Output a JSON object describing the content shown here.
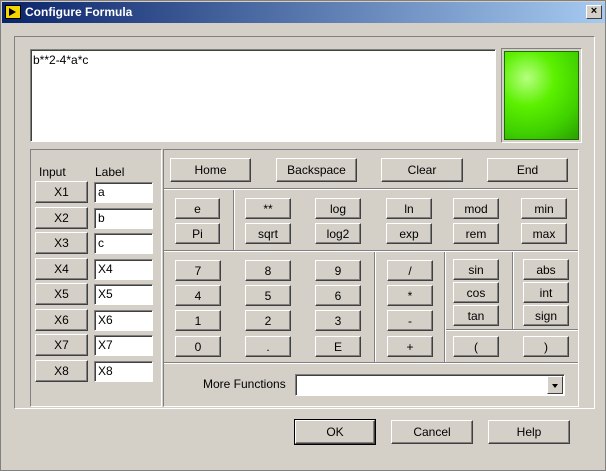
{
  "window": {
    "title": "Configure Formula",
    "close_label": "×"
  },
  "formula": {
    "value": "b**2-4*a*c"
  },
  "led": {
    "state": "on",
    "color": "#4ce000"
  },
  "variables": {
    "input_header": "Input",
    "label_header": "Label",
    "rows": [
      {
        "input": "X1",
        "label": "a"
      },
      {
        "input": "X2",
        "label": "b"
      },
      {
        "input": "X3",
        "label": "c"
      },
      {
        "input": "X4",
        "label": "X4"
      },
      {
        "input": "X5",
        "label": "X5"
      },
      {
        "input": "X6",
        "label": "X6"
      },
      {
        "input": "X7",
        "label": "X7"
      },
      {
        "input": "X8",
        "label": "X8"
      }
    ]
  },
  "edit": {
    "home": "Home",
    "backspace": "Backspace",
    "clear": "Clear",
    "end": "End"
  },
  "constants": {
    "e": "e",
    "pi": "Pi"
  },
  "functions": {
    "pow": "**",
    "log": "log",
    "ln": "ln",
    "mod": "mod",
    "min": "min",
    "sqrt": "sqrt",
    "log2": "log2",
    "exp": "exp",
    "rem": "rem",
    "max": "max"
  },
  "keypad": {
    "d7": "7",
    "d8": "8",
    "d9": "9",
    "d4": "4",
    "d5": "5",
    "d6": "6",
    "d1": "1",
    "d2": "2",
    "d3": "3",
    "d0": "0",
    "dot": ".",
    "E": "E"
  },
  "operators": {
    "divide": "/",
    "multiply": "*",
    "minus": "-",
    "plus": "+"
  },
  "trig": {
    "sin": "sin",
    "cos": "cos",
    "tan": "tan"
  },
  "misc": {
    "abs": "abs",
    "int": "int",
    "sign": "sign"
  },
  "parens": {
    "open": "(",
    "close": ")"
  },
  "more_functions": {
    "label": "More Functions",
    "value": ""
  },
  "footer": {
    "ok": "OK",
    "cancel": "Cancel",
    "help": "Help"
  }
}
